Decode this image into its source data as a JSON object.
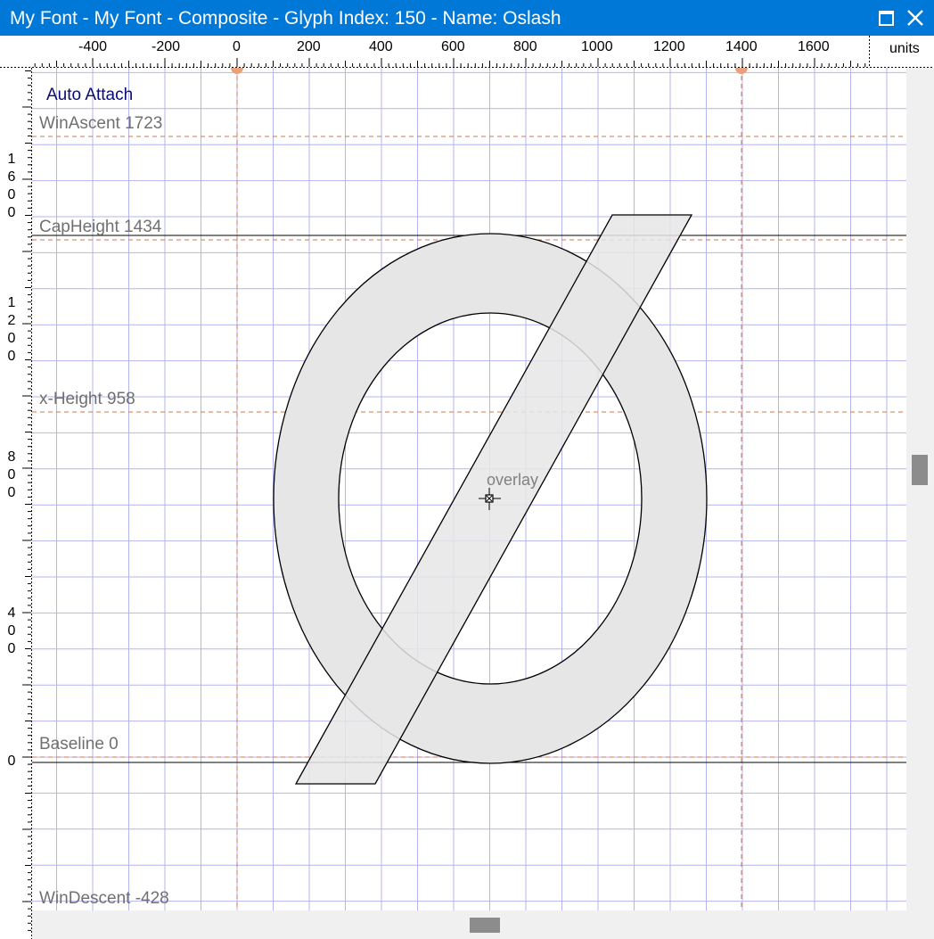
{
  "window": {
    "title": "My Font - My Font - Composite - Glyph Index: 150 - Name: Oslash"
  },
  "ruler": {
    "units_label": "units",
    "top_ticks": [
      "-400",
      "-200",
      "0",
      "200",
      "400",
      "600",
      "800",
      "1000",
      "1200",
      "1400",
      "1600"
    ],
    "left_ticks": [
      "1600",
      "1200",
      "800",
      "400",
      "0"
    ]
  },
  "canvas": {
    "auto_attach": "Auto Attach",
    "metrics": {
      "win_ascent": "WinAscent 1723",
      "cap_height": "CapHeight 1434",
      "x_height": "x-Height 958",
      "baseline": "Baseline 0",
      "win_descent": "WinDescent -428"
    },
    "overlay_label": "overlay"
  },
  "colors": {
    "titlebar": "#0078d7",
    "grid": "#b4b4ee",
    "guide": "#d27846",
    "glyph_fill": "#e6e6e6",
    "scroll_thumb": "#8c8c8c"
  },
  "icons": {
    "maximize": "maximize-icon",
    "close": "close-icon",
    "anchor": "anchor-crosshair-icon"
  }
}
